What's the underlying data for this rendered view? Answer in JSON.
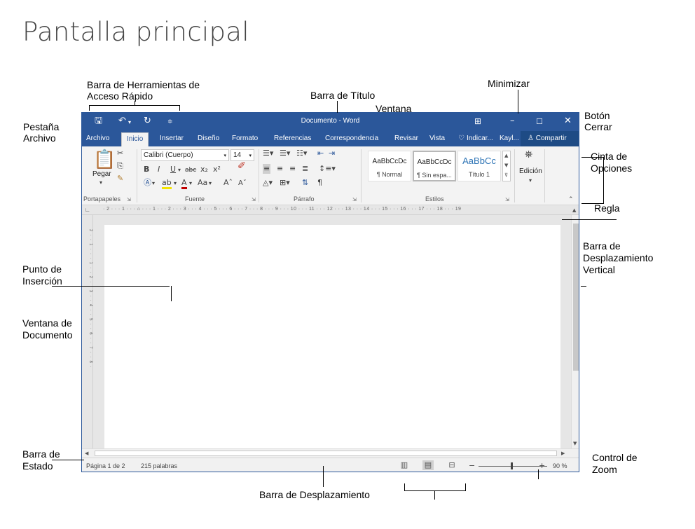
{
  "heading": "Pantalla principal",
  "callouts": {
    "qat": [
      "Barra de Herramientas de",
      "Acceso Rápido"
    ],
    "title_bar": "Barra de Título",
    "minimize": "Minimizar",
    "window": "Ventana",
    "close_button": [
      "Botón",
      "Cerrar"
    ],
    "file_tab": [
      "Pestaña",
      "Archivo"
    ],
    "ribbon": [
      "Cinta de",
      "Opciones"
    ],
    "ruler": "Regla",
    "vertical_scrollbar": [
      "Barra de",
      "Desplazamiento",
      "Vertical"
    ],
    "insertion_point": [
      "Punto de",
      "Inserción"
    ],
    "document_window": [
      "Ventana de",
      "Documento"
    ],
    "status_bar": [
      "Barra de",
      "Estado"
    ],
    "zoom_control": [
      "Control de",
      "Zoom"
    ],
    "scroll_bar": "Barra de Desplazamiento"
  },
  "word": {
    "title": "Documento - Word",
    "qat_icons": [
      "save-icon",
      "undo-icon",
      "redo-icon",
      "customize-icon"
    ],
    "window_icons": [
      "ribbon-display-icon",
      "minimize-icon",
      "maximize-icon",
      "close-icon"
    ],
    "tabs": [
      "Archivo",
      "Inicio",
      "Insertar",
      "Diseño",
      "Formato",
      "Referencias",
      "Correspondencia",
      "Revisar",
      "Vista",
      "Indicar...",
      "Kayl..."
    ],
    "active_tab": "Inicio",
    "share": "Compartir",
    "ribbon": {
      "paste_label": "Pegar",
      "font_name": "Calibri (Cuerpo)",
      "font_size": "14",
      "groups": [
        "Portapapeles",
        "Fuente",
        "Párrafo",
        "Estilos"
      ],
      "styles": [
        {
          "sample": "AaBbCcDc",
          "name": "¶ Normal"
        },
        {
          "sample": "AaBbCcDc",
          "name": "¶ Sin espa..."
        },
        {
          "sample": "AaBbCc",
          "name": "Título 1"
        }
      ],
      "edit_label": "Edición"
    },
    "ruler_ticks": "· 2 · · · 1 · · · ⌂ · · · 1 · · · 2 · · · 3 · · · 4 · · · 5 · · · 6 · · · 7 · · · 8 · · · 9 · · · 10 · · · 11 · · · 12 · · · 13 · · · 14 · · · 15 · · · 16 · · · 17 · · · 18 · · · 19",
    "vruler_ticks": "2 · · 1 · · · 1 · · 2 · · 3 · · 4 · · 5 · · 6 · · 7 · · 8 ·",
    "status": {
      "page": "Página 1 de 2",
      "words": "215 palabras",
      "zoom": "90 %"
    }
  },
  "colors": {
    "word_blue": "#2b579a",
    "ribbon_bg": "#f3f3f3",
    "doc_bg": "#e6e6e6"
  }
}
